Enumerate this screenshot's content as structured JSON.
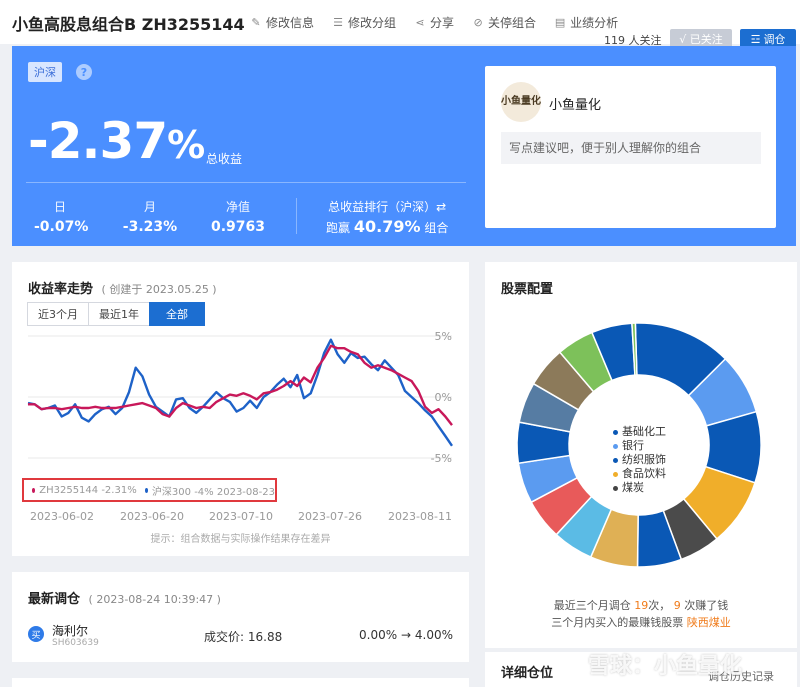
{
  "header": {
    "title": "小鱼高股息组合B ZH3255144",
    "actions": [
      "修改信息",
      "修改分组",
      "分享",
      "关停组合",
      "业绩分析"
    ],
    "follow_count": "119 人关注",
    "followed_label": "√ 已关注",
    "rebalance_label": "调仓"
  },
  "banner": {
    "market": "沪深",
    "help": "?",
    "total_return_number": "-2.37",
    "total_return_unit": "%",
    "total_return_label": "总收益",
    "stats": [
      {
        "label": "日",
        "value": "-0.07%"
      },
      {
        "label": "月",
        "value": "-3.23%"
      },
      {
        "label": "净值",
        "value": "0.9763"
      }
    ],
    "rank_label": "总收益排行（沪深）⇄",
    "rank_prefix": "跑赢",
    "rank_value": "40.79%",
    "rank_suffix": "组合"
  },
  "owner": {
    "avatar_text": "小鱼量化",
    "name": "小鱼量化",
    "tip": "写点建议吧，便于别人理解你的组合"
  },
  "trend": {
    "title": "收益率走势",
    "created": "( 创建于 2023.05.25 )",
    "tabs": [
      "近3个月",
      "最近1年",
      "全部"
    ],
    "hint": "提示：组合数据与实际操作结果存在差异"
  },
  "chart_data": {
    "type": "line",
    "x_ticks": [
      "2023-06-02",
      "2023-06-20",
      "2023-07-10",
      "2023-07-26",
      "2023-08-11"
    ],
    "y_ticks": [
      "5%",
      "0%",
      "-5%"
    ],
    "ylim": [
      -5,
      5
    ],
    "legend_text": [
      "ZH3255144 -2.31%",
      "沪深300 -4% 2023-08-23"
    ],
    "series": [
      {
        "name": "ZH3255144",
        "color": "#c8185a",
        "values": [
          -0.6,
          -0.6,
          -1.0,
          -0.9,
          -0.9,
          -1.0,
          -0.9,
          -0.8,
          -0.9,
          -0.9,
          -0.8,
          -0.9,
          -0.9,
          -0.9,
          -0.8,
          -0.7,
          -0.6,
          -0.5,
          -0.7,
          -0.9,
          -1.4,
          -1.6,
          -0.9,
          -0.5,
          -0.7,
          -0.9,
          -0.8,
          -0.9,
          -0.4,
          -0.1,
          0.2,
          0.1,
          0.3,
          0.1,
          -0.2,
          0.3,
          0.4,
          0.6,
          0.9,
          1.3,
          0.9,
          1.6,
          1.2,
          2.4,
          3.2,
          4.2,
          4.0,
          4.0,
          3.7,
          3.5,
          2.8,
          2.4,
          2.6,
          2.4,
          2.2,
          1.9,
          1.6,
          1.3,
          0.5,
          -0.8,
          -1.3,
          -1.0,
          -1.6,
          -2.3
        ]
      },
      {
        "name": "沪深300",
        "color": "#1e62c8",
        "values": [
          -0.5,
          -0.6,
          -1.0,
          -0.9,
          -0.7,
          -1.6,
          -1.3,
          -0.6,
          -1.7,
          -2.0,
          -1.4,
          -1.0,
          -0.8,
          -1.4,
          -0.9,
          0.4,
          2.4,
          1.7,
          0.2,
          -0.8,
          -1.2,
          -1.6,
          -0.2,
          -0.1,
          -0.9,
          -1.3,
          -0.8,
          -0.2,
          0.4,
          -0.1,
          -0.4,
          -1.2,
          -0.9,
          -0.3,
          -0.9,
          0.0,
          0.4,
          1.0,
          1.5,
          0.8,
          1.8,
          -0.1,
          0.3,
          1.8,
          3.6,
          4.7,
          3.5,
          2.8,
          3.6,
          3.2,
          3.3,
          2.7,
          2.2,
          3.0,
          2.4,
          1.8,
          0.5,
          0.0,
          -0.5,
          -1.1,
          -1.6,
          -2.4,
          -3.2,
          -4.0
        ]
      }
    ]
  },
  "latest_rebalance": {
    "title": "最新调仓",
    "time": "( 2023-08-24 10:39:47 )",
    "buy_label": "买",
    "stock_name": "海利尔",
    "stock_code": "SH603639",
    "price_label": "成交价:",
    "price": "16.88",
    "weight_from": "0.00%",
    "arrow": "→",
    "weight_to": "4.00%"
  },
  "allocation": {
    "title": "股票配置",
    "legend": [
      {
        "name": "基础化工",
        "color": "#0a58b5"
      },
      {
        "name": "银行",
        "color": "#5b9bf0"
      },
      {
        "name": "纺织服饰",
        "color": "#0a58b5"
      },
      {
        "name": "食品饮料",
        "color": "#f0ae2a"
      },
      {
        "name": "煤炭",
        "color": "#444444"
      }
    ],
    "donut": [
      {
        "value": 14.5,
        "color": "#0a58b5"
      },
      {
        "value": 9.0,
        "color": "#5b9bf0"
      },
      {
        "value": 10.5,
        "color": "#0a58b5"
      },
      {
        "value": 10.0,
        "color": "#f0ae2a"
      },
      {
        "value": 6.0,
        "color": "#4b4b4b"
      },
      {
        "value": 6.5,
        "color": "#0a58b5"
      },
      {
        "value": 7.0,
        "color": "#dfb055"
      },
      {
        "value": 6.0,
        "color": "#5bbbe5"
      },
      {
        "value": 6.0,
        "color": "#e85a5a"
      },
      {
        "value": 6.0,
        "color": "#5b9bf0"
      },
      {
        "value": 6.0,
        "color": "#0a58b5"
      },
      {
        "value": 6.0,
        "color": "#567ca3"
      },
      {
        "value": 6.0,
        "color": "#8c7a5a"
      },
      {
        "value": 5.5,
        "color": "#7dc15a"
      },
      {
        "value": 6.0,
        "color": "#0a58b5"
      },
      {
        "value": 0.5,
        "color": "#7dc15a"
      }
    ],
    "summary_prefix": "最近三个月调仓",
    "summary_count": "19",
    "summary_mid": "次，",
    "summary_win": "9",
    "summary_suffix": "次赚了钱",
    "best_prefix": "三个月内买入的最赚钱股票",
    "best_stock": "陕西煤业"
  },
  "holdings": {
    "title": "详细仓位",
    "history_link": "调仓历史记录"
  },
  "watermark": "雪球：小鱼量化"
}
